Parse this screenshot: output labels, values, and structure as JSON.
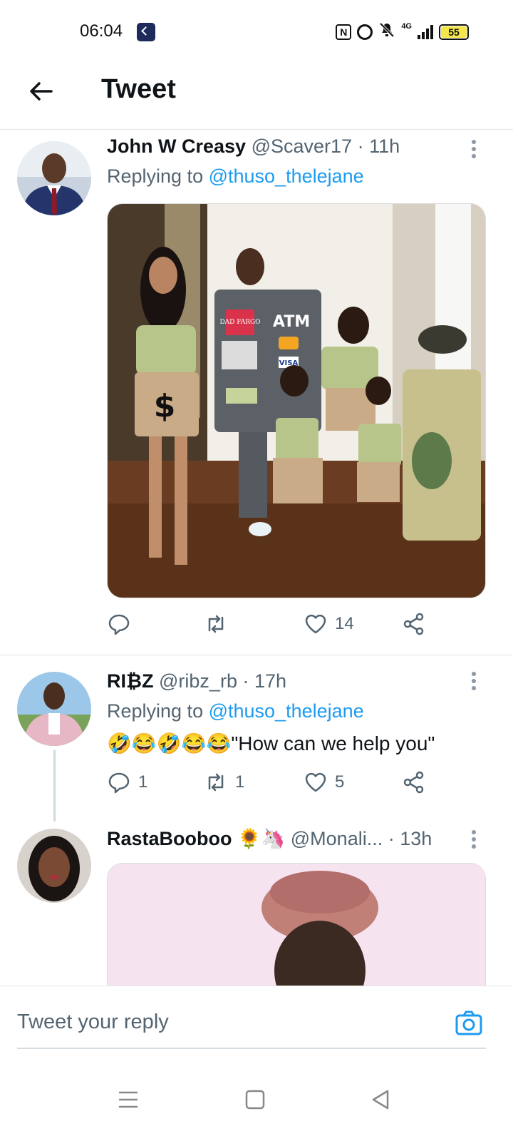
{
  "status_bar": {
    "time": "06:04",
    "network": "4G",
    "battery": "55",
    "icons": [
      "app-icon",
      "nfc-icon",
      "alarm-icon",
      "mute-icon",
      "signal-icon",
      "battery-icon"
    ]
  },
  "header": {
    "title": "Tweet",
    "back_icon": "arrow-left-icon"
  },
  "tweets": [
    {
      "name": "John W Creasy",
      "handle": "@Scaver17",
      "time": "· 11h",
      "replying_prefix": "Replying to ",
      "replying_to": "@thuso_thelejane",
      "has_media": true,
      "media_text": {
        "sign": "DAD FARGO",
        "atm": "ATM",
        "visa": "VISA",
        "dollar": "$"
      },
      "actions": {
        "reply": "",
        "retweet": "",
        "like": "14"
      }
    },
    {
      "name": "RI₿Z",
      "handle": "@ribz_rb",
      "time": "· 17h",
      "replying_prefix": "Replying to ",
      "replying_to": "@thuso_thelejane",
      "text": "🤣😂🤣😂😂\"How can we help you\"",
      "actions": {
        "reply": "1",
        "retweet": "1",
        "like": "5"
      }
    },
    {
      "name": "RastaBooboo 🌻🦄",
      "handle": "@Monali...",
      "time": "· 13h",
      "has_media": true
    }
  ],
  "reply_bar": {
    "placeholder": "Tweet your reply",
    "camera_icon": "camera-icon"
  },
  "nav_bar": {
    "icons": [
      "menu-icon",
      "home-square-icon",
      "back-triangle-icon"
    ]
  },
  "colors": {
    "accent": "#1d9bf0",
    "secondary_text": "#536471",
    "primary_text": "#0f1419"
  }
}
